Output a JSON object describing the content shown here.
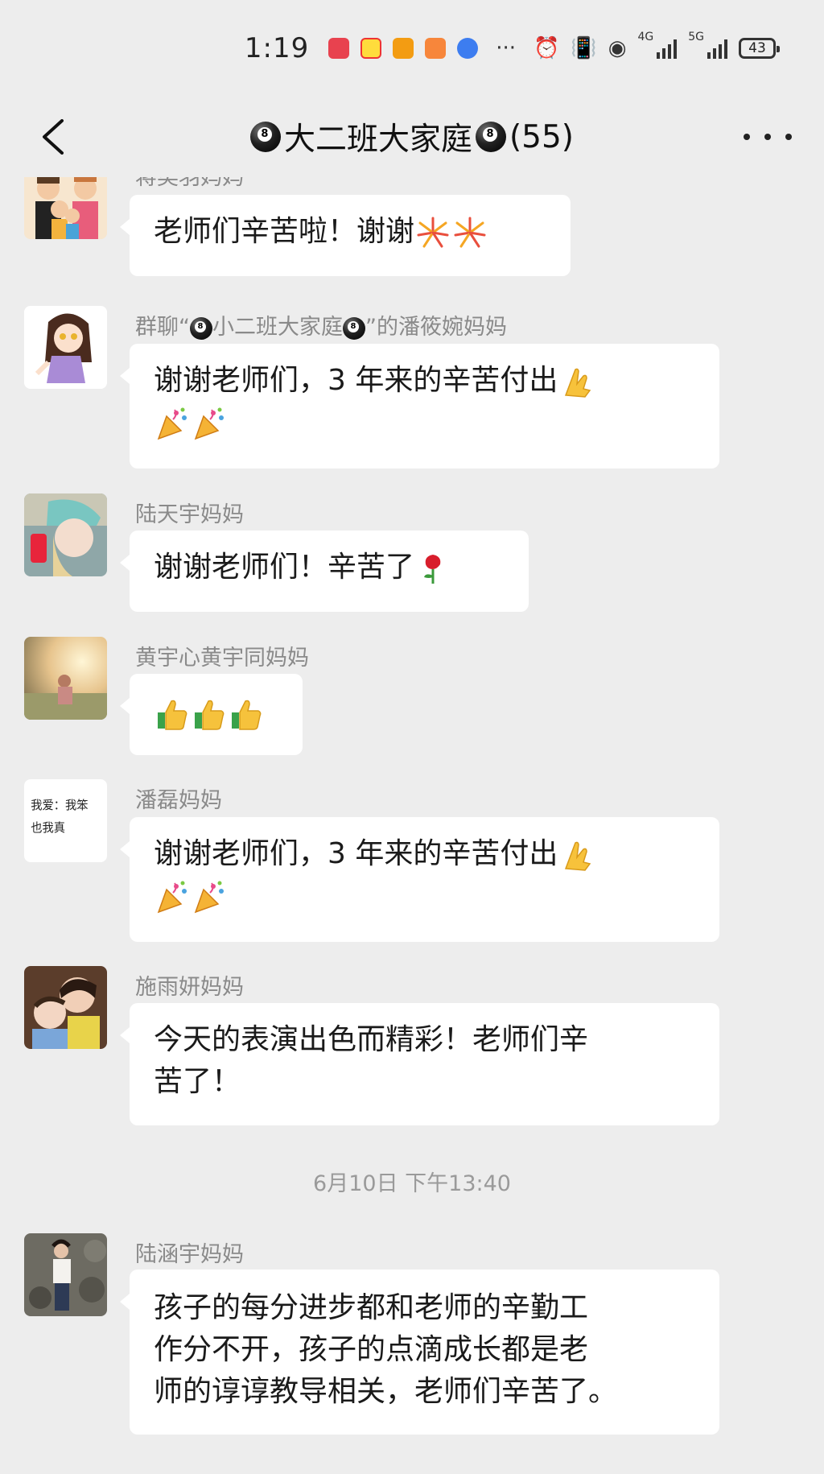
{
  "status_bar": {
    "time": "1:19",
    "more": "···",
    "network_1": "4G",
    "network_2": "5G",
    "battery": "43"
  },
  "nav": {
    "title_main": "大二班大家庭",
    "member_count": "(55)"
  },
  "messages": [
    {
      "sender": "蒋奕羽妈妈",
      "text": "老师们辛苦啦！谢谢",
      "emoji": [
        "fireworks",
        "fireworks"
      ]
    },
    {
      "sender_prefix": "群聊“",
      "sender_group": "小二班大家庭",
      "sender_suffix": "”的潘筱婉妈妈",
      "text": "谢谢老师们，3 年来的辛苦付出",
      "emoji": [
        "pray",
        "party-popper",
        "party-popper"
      ]
    },
    {
      "sender": "陆天宇妈妈",
      "text": "谢谢老师们！辛苦了",
      "emoji": [
        "rose"
      ]
    },
    {
      "sender": "黄宇心黄宇同妈妈",
      "text": "",
      "emoji": [
        "thumbs-up",
        "thumbs-up",
        "thumbs-up"
      ]
    },
    {
      "sender": "潘磊妈妈",
      "text": "谢谢老师们，3 年来的辛苦付出",
      "emoji": [
        "pray",
        "party-popper",
        "party-popper"
      ],
      "avatar_text": "我爱：我笨\n也我真"
    },
    {
      "sender": "施雨妍妈妈",
      "text_line1": "今天的表演出色而精彩！老师们辛",
      "text_line2": "苦了！"
    },
    {
      "sender": "陆涵宇妈妈",
      "text_line1": "孩子的每分进步都和老师的辛勤工",
      "text_line2": "作分不开，孩子的点滴成长都是老",
      "text_line3": "师的谆谆教导相关，老师们辛苦了。"
    }
  ],
  "timestamp": "6月10日 下午13:40",
  "colors": {
    "background": "#ededed",
    "bubble": "#ffffff",
    "sender_name": "#8a8a8a"
  }
}
